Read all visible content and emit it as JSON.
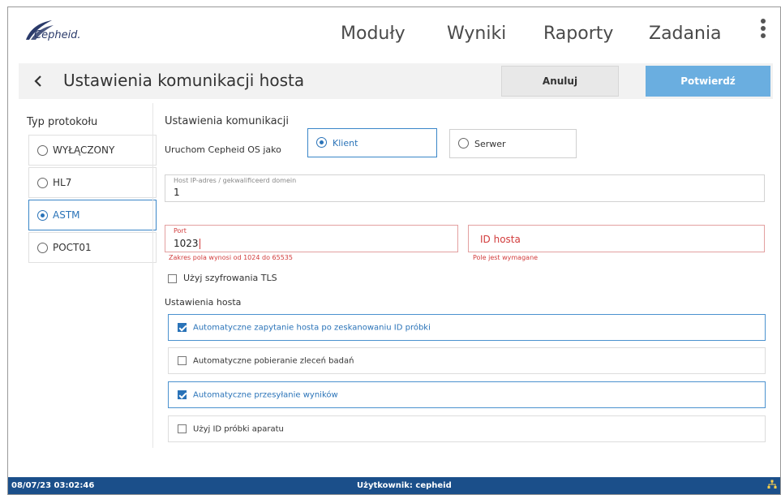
{
  "brand": {
    "logo_text": "Cepheid."
  },
  "nav": {
    "items": [
      "Moduły",
      "Wyniki",
      "Raporty",
      "Zadania"
    ],
    "menu_icon": "kebab-vertical-icon"
  },
  "header": {
    "title": "Ustawienia komunikacji hosta",
    "back_icon": "chevron-left-icon",
    "cancel_label": "Anuluj",
    "confirm_label": "Potwierdź"
  },
  "protocol": {
    "heading": "Typ protokołu",
    "options": [
      {
        "label": "WYŁĄCZONY",
        "selected": false
      },
      {
        "label": "HL7",
        "selected": false
      },
      {
        "label": "ASTM",
        "selected": true
      },
      {
        "label": "POCT01",
        "selected": false
      }
    ]
  },
  "comm": {
    "heading": "Ustawienia komunikacji",
    "run_as_label": "Uruchom Cepheid OS jako",
    "client_label": "Klient",
    "server_label": "Serwer",
    "selected_mode": "Klient",
    "host_ip_label": "Host IP-adres / gekwalificeerd domein",
    "host_ip_value": "1",
    "port_label": "Port",
    "port_value": "1023",
    "port_error": "Zakres pola wynosi od 1024 do 65535",
    "host_id_placeholder": "ID hosta",
    "host_id_error": "Pole jest wymagane",
    "tls_label": "Użyj szyfrowania TLS",
    "tls_checked": false
  },
  "host": {
    "heading": "Ustawienia hosta",
    "options": [
      {
        "label": "Automatyczne zapytanie hosta po zeskanowaniu ID próbki",
        "checked": true
      },
      {
        "label": "Automatyczne pobieranie zleceń badań",
        "checked": false
      },
      {
        "label": "Automatyczne przesyłanie wyników",
        "checked": true
      },
      {
        "label": "Użyj ID próbki aparatu",
        "checked": false
      }
    ]
  },
  "footer": {
    "timestamp": "08/07/23 03:02:46",
    "user": "Użytkownik: cepheid",
    "network_icon": "network-icon"
  },
  "colors": {
    "accent": "#2a73b8",
    "confirm_button": "#6aaee0",
    "footer_bg": "#1b4f8a",
    "error": "#d23c3c"
  }
}
